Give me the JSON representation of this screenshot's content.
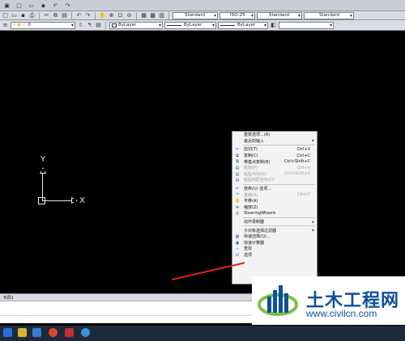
{
  "toolbar": {
    "layer_value": "0",
    "text_style": "Standard",
    "dim_style": "ISO-25",
    "table_style": "Standard",
    "multileader_style": "Standard",
    "color": "ByLayer",
    "linetype": "ByLayer",
    "lineweight": "ByLayer"
  },
  "ucs": {
    "y_label": "Y",
    "x_label": "X"
  },
  "context_menu": [
    {
      "label": "重复选项...(R)",
      "shortcut": "",
      "submenu": false,
      "disabled": false,
      "icon": ""
    },
    {
      "label": "最近的输入",
      "shortcut": "",
      "submenu": true,
      "disabled": false,
      "icon": ""
    },
    {
      "sep": true
    },
    {
      "label": "剪切(T)",
      "shortcut": "Ctrl+X",
      "submenu": false,
      "disabled": false,
      "icon": "scissors-icon"
    },
    {
      "label": "复制(C)",
      "shortcut": "Ctrl+C",
      "submenu": false,
      "disabled": false,
      "icon": "copy-icon"
    },
    {
      "label": "带基点复制(B)",
      "shortcut": "Ctrl+Shift+C",
      "submenu": false,
      "disabled": false,
      "icon": "copy-base-icon"
    },
    {
      "label": "粘贴(P)",
      "shortcut": "Ctrl+V",
      "submenu": false,
      "disabled": true,
      "icon": "paste-icon"
    },
    {
      "label": "粘贴为块(K)",
      "shortcut": "Ctrl+Shift+V",
      "submenu": false,
      "disabled": true,
      "icon": "paste-block-icon"
    },
    {
      "label": "粘贴到原坐标(D)",
      "shortcut": "",
      "submenu": false,
      "disabled": true,
      "icon": "paste-orig-icon"
    },
    {
      "sep": true
    },
    {
      "label": "放弃(U) 选项...",
      "shortcut": "",
      "submenu": false,
      "disabled": false,
      "icon": "undo-icon"
    },
    {
      "label": "重做(R)",
      "shortcut": "Ctrl+Y",
      "submenu": false,
      "disabled": true,
      "icon": "redo-icon"
    },
    {
      "label": "平移(A)",
      "shortcut": "",
      "submenu": false,
      "disabled": false,
      "icon": "pan-icon"
    },
    {
      "label": "缩放(Z)",
      "shortcut": "",
      "submenu": false,
      "disabled": false,
      "icon": "zoom-icon"
    },
    {
      "label": "SteeringWheels",
      "shortcut": "",
      "submenu": false,
      "disabled": false,
      "icon": "wheel-icon"
    },
    {
      "sep": true
    },
    {
      "label": "动作录制器",
      "shortcut": "",
      "submenu": true,
      "disabled": false,
      "icon": ""
    },
    {
      "sep": true
    },
    {
      "label": "子对象选择过滤器",
      "shortcut": "",
      "submenu": true,
      "disabled": false,
      "icon": ""
    },
    {
      "label": "快速选择(Q)...",
      "shortcut": "",
      "submenu": false,
      "disabled": false,
      "icon": "qselect-icon"
    },
    {
      "label": "快速计算器",
      "shortcut": "",
      "submenu": false,
      "disabled": false,
      "icon": "calc-icon"
    },
    {
      "label": "查找",
      "shortcut": "",
      "submenu": false,
      "disabled": false,
      "icon": "find-icon"
    },
    {
      "label": "选项",
      "shortcut": "",
      "submenu": false,
      "disabled": false,
      "icon": "options-icon"
    }
  ],
  "layout_tab": "布局1",
  "watermark": {
    "title": "土木工程网",
    "url": "www.civilcn.com"
  },
  "colors": {
    "canvas": "#000000",
    "menu_bg": "#f3f3f3",
    "arrow": "#e02020",
    "brand": "#0d4f9c"
  }
}
